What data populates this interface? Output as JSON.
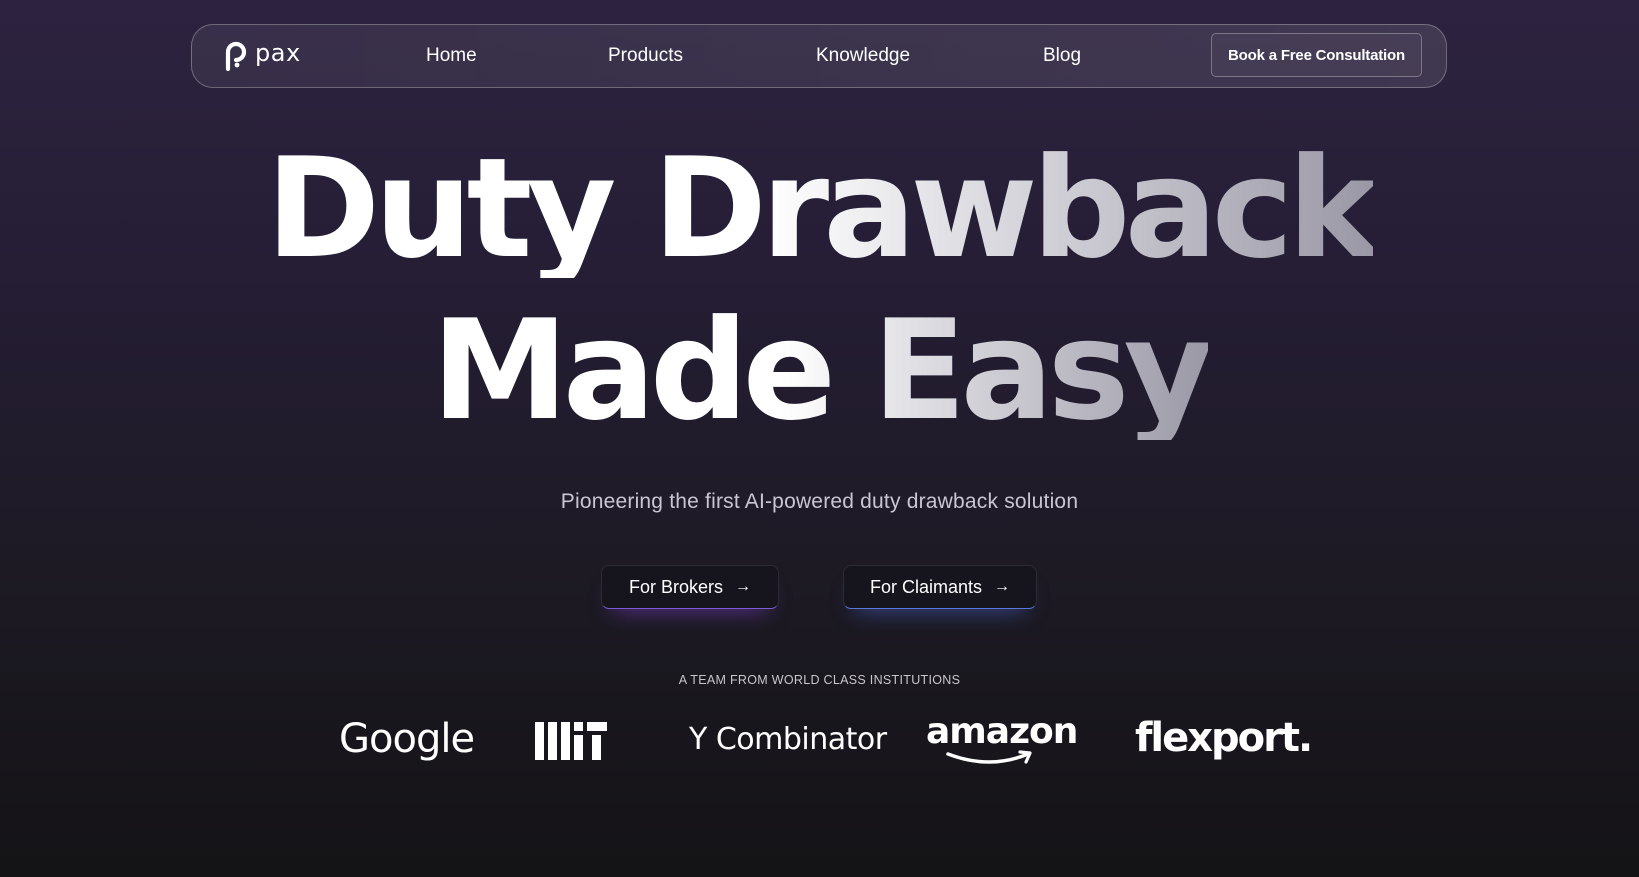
{
  "nav": {
    "logo_text": "pax",
    "links": [
      "Home",
      "Products",
      "Knowledge",
      "Blog"
    ],
    "cta_label": "Book a Free Consultation"
  },
  "hero": {
    "line1": "Duty Drawback",
    "line2": "Made Easy",
    "subtitle": "Pioneering the first AI-powered duty drawback solution"
  },
  "buttons": {
    "brokers": "For Brokers",
    "claimants": "For Claimants",
    "brokers_glow": "#8c46e6",
    "claimants_glow": "#506ee6"
  },
  "team": {
    "label": "A TEAM FROM WORLD CLASS INSTITUTIONS",
    "logos": [
      "Google",
      "MIT",
      "Y Combinator",
      "amazon",
      "flexport."
    ]
  },
  "icons": {
    "logo": "pax-logo-icon",
    "arrow": "arrow-right-icon"
  }
}
